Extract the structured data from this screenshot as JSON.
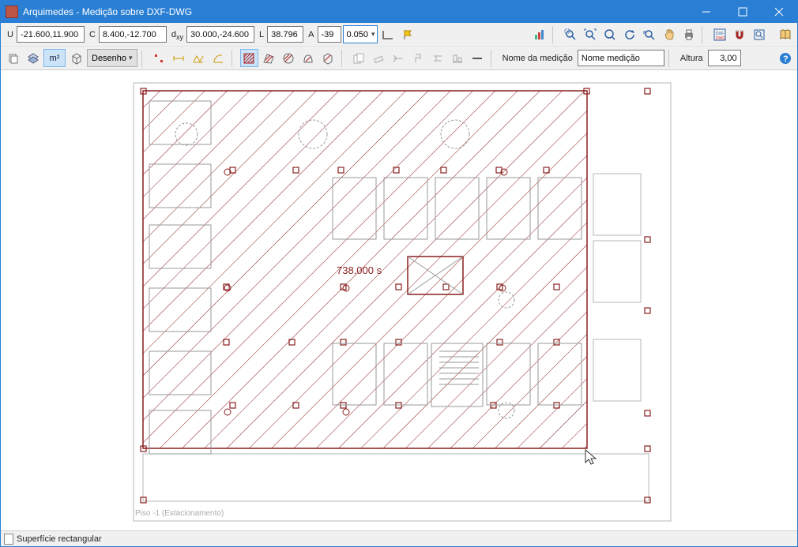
{
  "window": {
    "title": "Arquimedes - Medição sobre DXF-DWG"
  },
  "coords": {
    "u_label": "U",
    "u_value": "-21.600,11.900",
    "c_label": "C",
    "c_value": "8.400,-12.700",
    "dxy_label": "dxy",
    "dxy_value": "30.000,-24.600",
    "L_label": "L",
    "L_value": "38.796",
    "A_label": "A",
    "A_value": "-39",
    "snap_value": "0.050"
  },
  "row2": {
    "unit_btn": "m²",
    "mode_label": "Desenho"
  },
  "measure": {
    "name_label": "Nome da medição",
    "name_value": "Nome medição",
    "height_label": "Altura",
    "height_value": "3,00"
  },
  "canvas": {
    "area_text": "738.000 s",
    "footer_text": "Piso -1 (Estacionamento)"
  },
  "status": {
    "text": "Superfície rectangular"
  }
}
